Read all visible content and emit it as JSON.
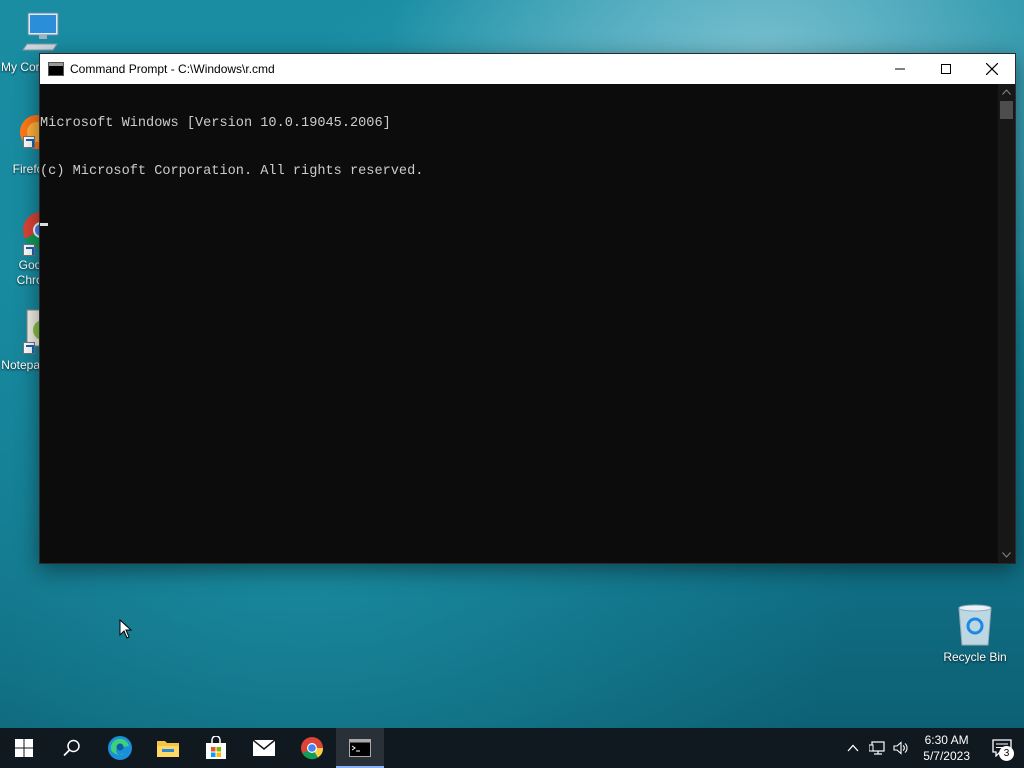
{
  "desktop": {
    "icons": [
      {
        "label": "My Computer",
        "name": "my-computer"
      },
      {
        "label": "Firefox",
        "name": "firefox"
      },
      {
        "label": "Google Chrome",
        "name": "google-chrome"
      },
      {
        "label": "Notepad++",
        "name": "notepad-plus-plus"
      }
    ],
    "recycle_bin_label": "Recycle Bin"
  },
  "window": {
    "title": "Command Prompt - C:\\Windows\\r.cmd",
    "console_lines": [
      "Microsoft Windows [Version 10.0.19045.2006]",
      "(c) Microsoft Corporation. All rights reserved."
    ]
  },
  "taskbar": {
    "apps": [
      "start-icon",
      "search-icon",
      "edge-icon",
      "file-explorer-icon",
      "store-icon",
      "mail-icon",
      "chrome-icon",
      "command-prompt-icon"
    ],
    "active_app": "command-prompt-icon",
    "clock_time": "6:30 AM",
    "clock_date": "5/7/2023",
    "notification_count": "3"
  },
  "colors": {
    "taskbar": "#101820",
    "console_bg": "#0c0c0c",
    "console_text": "#cccccc",
    "titlebar": "#ffffff"
  }
}
